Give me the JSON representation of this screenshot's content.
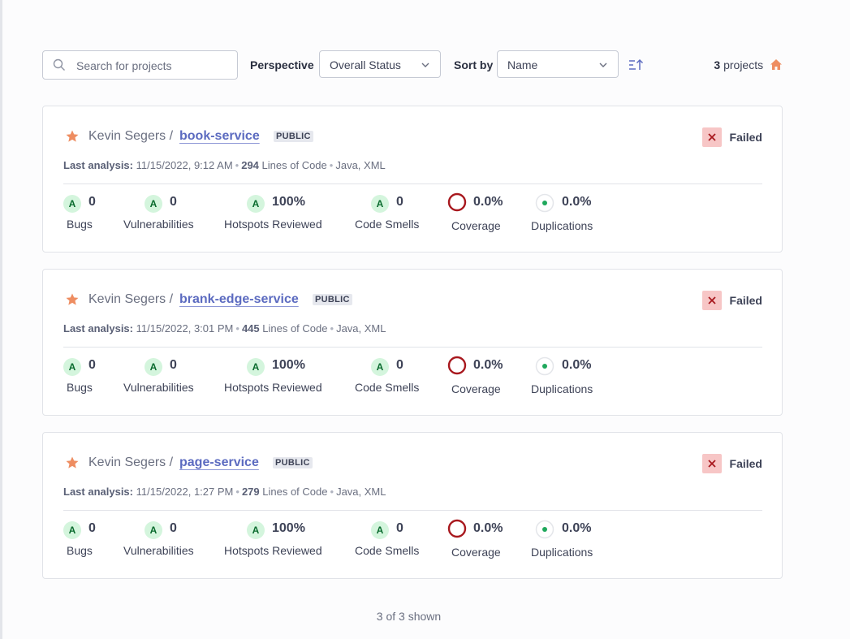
{
  "search": {
    "placeholder": "Search for projects",
    "value": ""
  },
  "perspective": {
    "label": "Perspective",
    "value": "Overall Status"
  },
  "sort": {
    "label": "Sort by",
    "value": "Name"
  },
  "count": {
    "number": "3",
    "suffix": "projects"
  },
  "projects": [
    {
      "owner": "Kevin Segers /",
      "name": "book-service",
      "visibility": "PUBLIC",
      "status": "Failed",
      "analysis_label": "Last analysis:",
      "analysis_date": "11/15/2022, 9:12 AM",
      "loc": "294",
      "loc_label": "Lines of Code",
      "languages": "Java, XML",
      "bugs": {
        "rating": "A",
        "value": "0",
        "label": "Bugs"
      },
      "vulnerabilities": {
        "rating": "A",
        "value": "0",
        "label": "Vulnerabilities"
      },
      "hotspots": {
        "rating": "A",
        "value": "100%",
        "label": "Hotspots Reviewed"
      },
      "smells": {
        "rating": "A",
        "value": "0",
        "label": "Code Smells"
      },
      "coverage": {
        "value": "0.0%",
        "label": "Coverage"
      },
      "duplications": {
        "value": "0.0%",
        "label": "Duplications"
      }
    },
    {
      "owner": "Kevin Segers /",
      "name": "brank-edge-service",
      "visibility": "PUBLIC",
      "status": "Failed",
      "analysis_label": "Last analysis:",
      "analysis_date": "11/15/2022, 3:01 PM",
      "loc": "445",
      "loc_label": "Lines of Code",
      "languages": "Java, XML",
      "bugs": {
        "rating": "A",
        "value": "0",
        "label": "Bugs"
      },
      "vulnerabilities": {
        "rating": "A",
        "value": "0",
        "label": "Vulnerabilities"
      },
      "hotspots": {
        "rating": "A",
        "value": "100%",
        "label": "Hotspots Reviewed"
      },
      "smells": {
        "rating": "A",
        "value": "0",
        "label": "Code Smells"
      },
      "coverage": {
        "value": "0.0%",
        "label": "Coverage"
      },
      "duplications": {
        "value": "0.0%",
        "label": "Duplications"
      }
    },
    {
      "owner": "Kevin Segers /",
      "name": "page-service",
      "visibility": "PUBLIC",
      "status": "Failed",
      "analysis_label": "Last analysis:",
      "analysis_date": "11/15/2022, 1:27 PM",
      "loc": "279",
      "loc_label": "Lines of Code",
      "languages": "Java, XML",
      "bugs": {
        "rating": "A",
        "value": "0",
        "label": "Bugs"
      },
      "vulnerabilities": {
        "rating": "A",
        "value": "0",
        "label": "Vulnerabilities"
      },
      "hotspots": {
        "rating": "A",
        "value": "100%",
        "label": "Hotspots Reviewed"
      },
      "smells": {
        "rating": "A",
        "value": "0",
        "label": "Code Smells"
      },
      "coverage": {
        "value": "0.0%",
        "label": "Coverage"
      },
      "duplications": {
        "value": "0.0%",
        "label": "Duplications"
      }
    }
  ],
  "footer": {
    "shown": "3 of 3 shown"
  },
  "colors": {
    "accent": "#5c6bc0",
    "failed_bg": "#f7c6c6",
    "failed_x": "#a8181e",
    "rating_bg": "#d4f5dd",
    "star": "#ee8d61",
    "coverage_ring": "#a8181e",
    "dup_dot": "#1fa85c"
  }
}
